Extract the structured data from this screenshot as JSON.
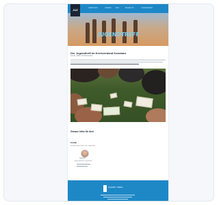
{
  "nav": {
    "logo": "JUZ",
    "items": [
      "STARTSEITE",
      "THEMEN",
      "INFO",
      "ANGEBOTE",
      "JUGENDARBEIT"
    ]
  },
  "hero": {
    "title": "JUGENDTREFF"
  },
  "article": {
    "title": "Der Jugendtreff im Kreisverband Konstanz",
    "meta": "Juni 01, 2020 • 15 Kommentare"
  },
  "section": {
    "title": "Genaue Infos für dich",
    "contact_label": "Kontakt",
    "contact_note": "Für alle Fragen rund um den Jugendtreff",
    "person_name": "Lisa Kraft",
    "person_role": "Ansprechpartnerin Jugendarbeit"
  },
  "footer": {
    "brand": "JUGEND • TREFF"
  },
  "colors": {
    "accent": "#1e88c7",
    "footer": "#1e88c7",
    "dark": "#1b2433"
  }
}
